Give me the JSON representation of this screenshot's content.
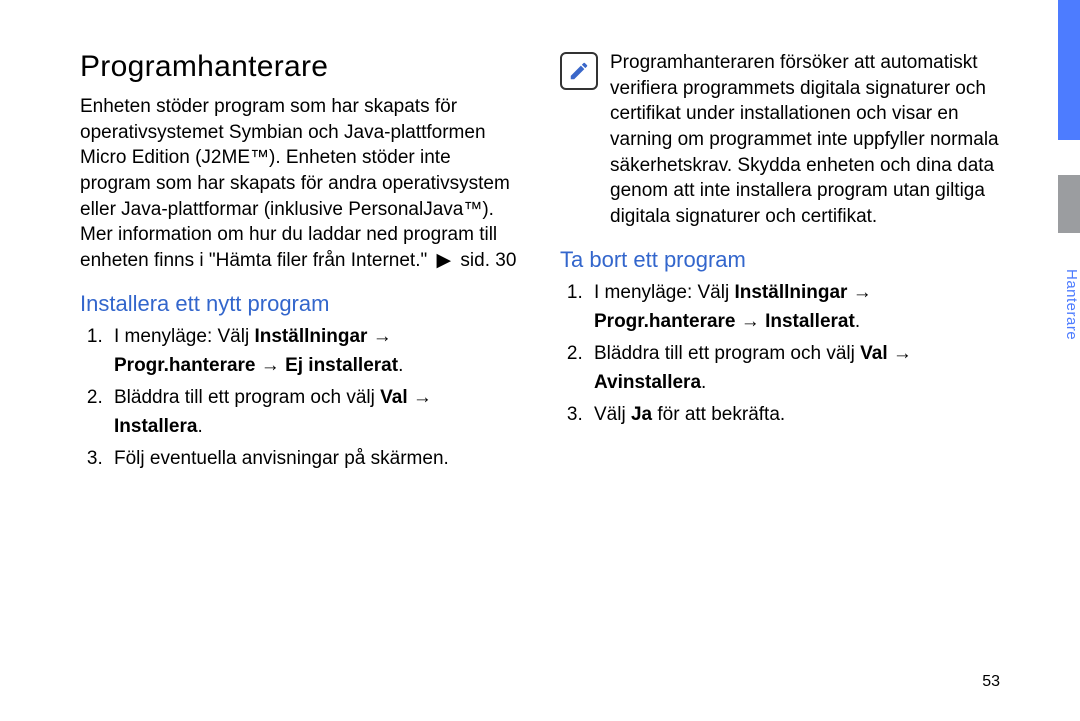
{
  "heading": "Programhanterare",
  "intro_parts": {
    "p1": "Enheten stöder program som har skapats för operativsystemet Symbian och Java-plattformen Micro Edition (J2ME™). Enheten stöder inte program som har skapats för andra operativsystem eller Java-plattformar (inklusive PersonalJava™). Mer information om hur du laddar ned program till enheten finns i \"Hämta filer från Internet.\"",
    "arrow": "▶",
    "p2": "sid. 30"
  },
  "install": {
    "title": "Installera ett nytt program",
    "li1_a": "I menyläge: Välj ",
    "li1_b": "Inställningar",
    "li1_arrow1": " → ",
    "li1_c": "Progr.hanterare",
    "li1_arrow2": " → ",
    "li1_d": "Ej installerat",
    "li1_e": ".",
    "li2_a": "Bläddra till ett program och välj ",
    "li2_b": "Val",
    "li2_arrow": " → ",
    "li2_c": "Installera",
    "li2_d": ".",
    "li3": "Följ eventuella anvisningar på skärmen."
  },
  "note": "Programhanteraren försöker att automatiskt verifiera programmets digitala signaturer och certifikat under installationen och visar en varning om programmet inte uppfyller normala säkerhetskrav. Skydda enheten och dina data genom att inte installera program utan giltiga digitala signaturer och certifikat.",
  "remove": {
    "title": "Ta bort ett program",
    "li1_a": "I menyläge: Välj ",
    "li1_b": "Inställningar",
    "li1_arrow1": " → ",
    "li1_c": "Progr.hanterare",
    "li1_arrow2": " → ",
    "li1_d": "Installerat",
    "li1_e": ".",
    "li2_a": "Bläddra till ett program och välj ",
    "li2_b": "Val",
    "li2_arrow": " → ",
    "li2_c": "Avinstallera",
    "li2_d": ".",
    "li3_a": "Välj ",
    "li3_b": "Ja",
    "li3_c": " för att bekräfta."
  },
  "side_label": "Hanterare",
  "page_number": "53"
}
